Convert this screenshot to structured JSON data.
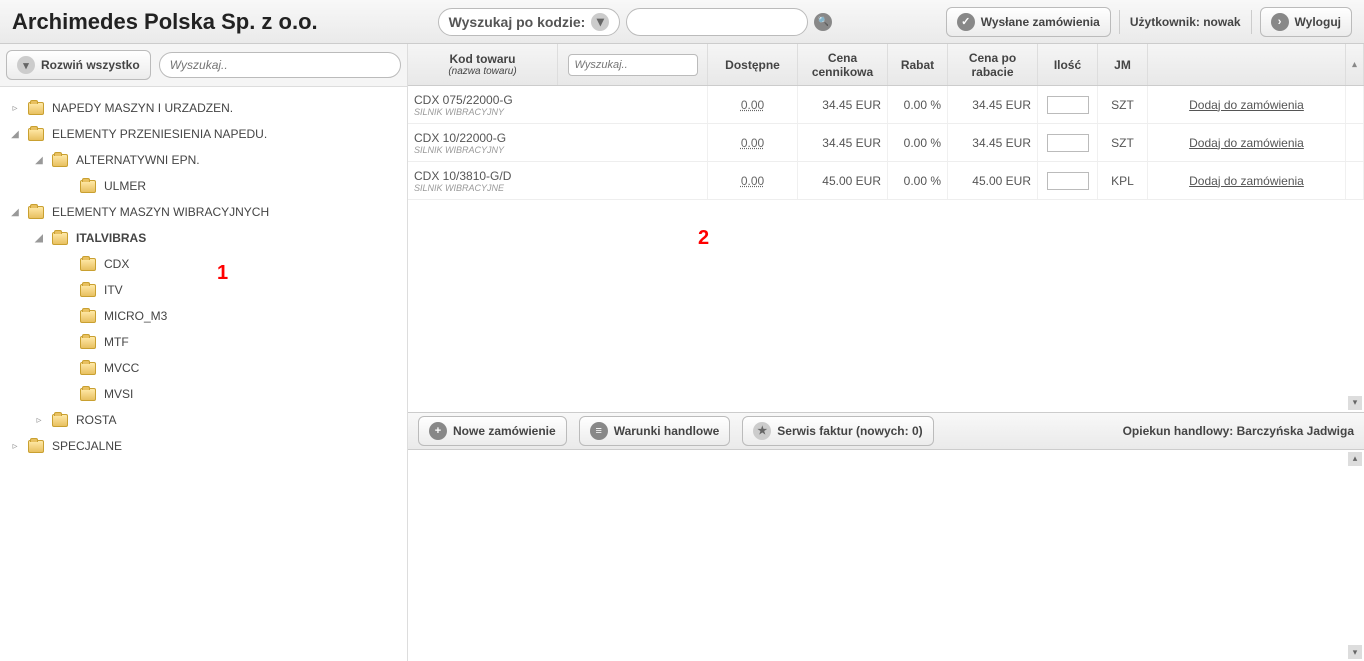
{
  "header": {
    "company": "Archimedes Polska Sp. z o.o.",
    "search_code_label": "Wyszukaj po kodzie:",
    "btn_sent_orders": "Wysłane zamówienia",
    "user_label": "Użytkownik: nowak",
    "btn_logout": "Wyloguj"
  },
  "sidebar": {
    "btn_expand_all": "Rozwiń wszystko",
    "search_placeholder": "Wyszukaj..",
    "tree": [
      {
        "label": "NAPEDY MASZYN I URZADZEN.",
        "level": 0,
        "toggle": "▹",
        "bold": false
      },
      {
        "label": "ELEMENTY PRZENIESIENIA NAPEDU.",
        "level": 0,
        "toggle": "◢",
        "bold": false
      },
      {
        "label": "ALTERNATYWNI EPN.",
        "level": 1,
        "toggle": "◢",
        "bold": false
      },
      {
        "label": "ULMER",
        "level": 2,
        "toggle": "",
        "bold": false
      },
      {
        "label": "ELEMENTY MASZYN WIBRACYJNYCH",
        "level": 0,
        "toggle": "◢",
        "bold": false
      },
      {
        "label": "ITALVIBRAS",
        "level": 1,
        "toggle": "◢",
        "bold": true
      },
      {
        "label": "CDX",
        "level": 2,
        "toggle": "",
        "bold": false
      },
      {
        "label": "ITV",
        "level": 2,
        "toggle": "",
        "bold": false
      },
      {
        "label": "MICRO_M3",
        "level": 2,
        "toggle": "",
        "bold": false
      },
      {
        "label": "MTF",
        "level": 2,
        "toggle": "",
        "bold": false
      },
      {
        "label": "MVCC",
        "level": 2,
        "toggle": "",
        "bold": false
      },
      {
        "label": "MVSI",
        "level": 2,
        "toggle": "",
        "bold": false
      },
      {
        "label": "ROSTA",
        "level": 1,
        "toggle": "▹",
        "bold": false
      },
      {
        "label": "SPECJALNE",
        "level": 0,
        "toggle": "▹",
        "bold": false
      }
    ]
  },
  "grid": {
    "headers": {
      "kod": "Kod towaru",
      "kod_sub": "(nazwa towaru)",
      "search_placeholder": "Wyszukaj..",
      "available": "Dostępne",
      "price": "Cena cennikowa",
      "rabat": "Rabat",
      "price_after": "Cena po rabacie",
      "qty": "Ilość",
      "jm": "JM"
    },
    "rows": [
      {
        "code": "CDX 075/22000-G",
        "desc": "SILNIK WIBRACYJNY",
        "avail": "0.00",
        "price": "34.45 EUR",
        "rabat": "0.00 %",
        "price_after": "34.45 EUR",
        "jm": "SZT",
        "action": "Dodaj do  zamówienia"
      },
      {
        "code": "CDX 10/22000-G",
        "desc": "SILNIK WIBRACYJNY",
        "avail": "0.00",
        "price": "34.45 EUR",
        "rabat": "0.00 %",
        "price_after": "34.45 EUR",
        "jm": "SZT",
        "action": "Dodaj do  zamówienia"
      },
      {
        "code": "CDX 10/3810-G/D",
        "desc": "SILNIK WIBRACYJNE",
        "avail": "0.00",
        "price": "45.00 EUR",
        "rabat": "0.00 %",
        "price_after": "45.00 EUR",
        "jm": "KPL",
        "action": "Dodaj do  zamówienia"
      }
    ]
  },
  "bottom": {
    "btn_new_order": "Nowe zamówienie",
    "btn_terms": "Warunki handlowe",
    "btn_invoices": "Serwis faktur (nowych: 0)",
    "opiekun": "Opiekun handlowy: Barczyńska Jadwiga"
  },
  "markers": {
    "m1": "1",
    "m2": "2"
  }
}
